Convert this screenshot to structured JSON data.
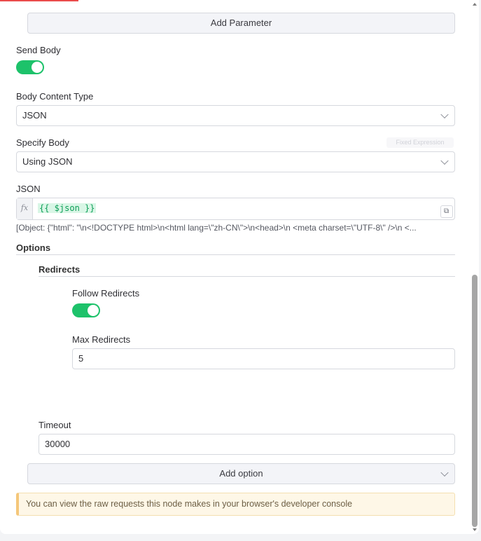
{
  "params": {
    "add_parameter_label": "Add Parameter"
  },
  "send_body": {
    "label": "Send Body",
    "enabled": true
  },
  "body_content_type": {
    "label": "Body Content Type",
    "value": "JSON"
  },
  "specify_body": {
    "label": "Specify Body",
    "value": "Using JSON",
    "mode_toggle": "Fixed Expression"
  },
  "json": {
    "label": "JSON",
    "fx_label": "fx",
    "expression": "{{ $json }}",
    "result_preview": "[Object: {\"html\": \"\\n<!DOCTYPE html>\\n<html lang=\\\"zh-CN\\\">\\n<head>\\n  <meta charset=\\\"UTF-8\\\" />\\n  <..."
  },
  "options": {
    "label": "Options",
    "redirects": {
      "label": "Redirects",
      "follow_label": "Follow Redirects",
      "follow_enabled": true,
      "max_label": "Max Redirects",
      "max_value": "5"
    },
    "timeout": {
      "label": "Timeout",
      "value": "30000"
    },
    "add_option_label": "Add option"
  },
  "notice": {
    "text": "You can view the raw requests this node makes in your browser's developer console"
  },
  "icons": {
    "chevron": "chevron-down-icon",
    "expand": "expand-icon"
  },
  "colors": {
    "toggle_on": "#1dc26a",
    "accent": "#ea4b4b",
    "notice_bg": "#fef7e7",
    "notice_border": "#f5c77a"
  }
}
